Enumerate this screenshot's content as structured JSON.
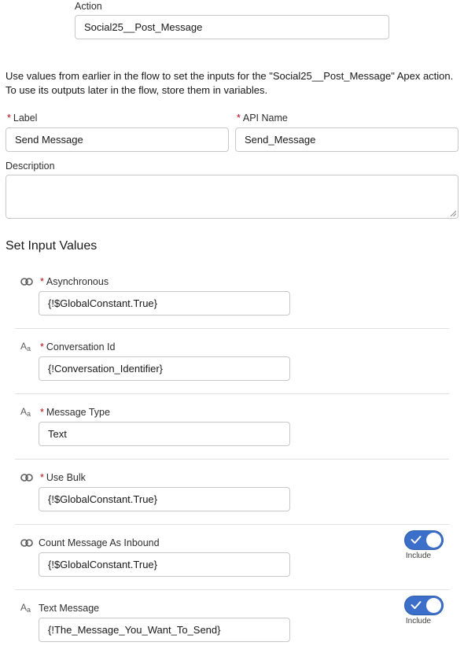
{
  "action": {
    "label": "Action",
    "value": "Social25__Post_Message"
  },
  "intro_text": "Use values from earlier in the flow to set the inputs for the \"Social25__Post_Message\" Apex action. To use its outputs later in the flow, store them in variables.",
  "label_field": {
    "label": "Label",
    "value": "Send Message",
    "required": true
  },
  "api_name_field": {
    "label": "API Name",
    "value": "Send_Message",
    "required": true
  },
  "description_field": {
    "label": "Description",
    "value": ""
  },
  "section_title": "Set Input Values",
  "required_marker": "*",
  "inputs": [
    {
      "type_icon": "boolean-icon",
      "label": "Asynchronous",
      "required": true,
      "value": "{!$GlobalConstant.True}",
      "has_toggle": false
    },
    {
      "type_icon": "text-type-icon",
      "label": "Conversation Id",
      "required": true,
      "value": "{!Conversation_Identifier}",
      "has_toggle": false
    },
    {
      "type_icon": "text-type-icon",
      "label": "Message Type",
      "required": true,
      "value": "Text",
      "has_toggle": false
    },
    {
      "type_icon": "boolean-icon",
      "label": "Use Bulk",
      "required": true,
      "value": "{!$GlobalConstant.True}",
      "has_toggle": false
    },
    {
      "type_icon": "boolean-icon",
      "label": "Count Message As Inbound",
      "required": false,
      "value": "{!$GlobalConstant.True}",
      "has_toggle": true,
      "toggle_on": true,
      "toggle_label": "Include"
    },
    {
      "type_icon": "text-type-icon",
      "label": "Text Message",
      "required": false,
      "value": "{!The_Message_You_Want_To_Send}",
      "has_toggle": true,
      "toggle_on": true,
      "toggle_label": "Include"
    }
  ],
  "text_icon_glyph": {
    "big": "A",
    "small": "a"
  },
  "colors": {
    "toggle_on": "#3b6fc9",
    "required": "#ba0517",
    "border": "#c9c9c9"
  }
}
